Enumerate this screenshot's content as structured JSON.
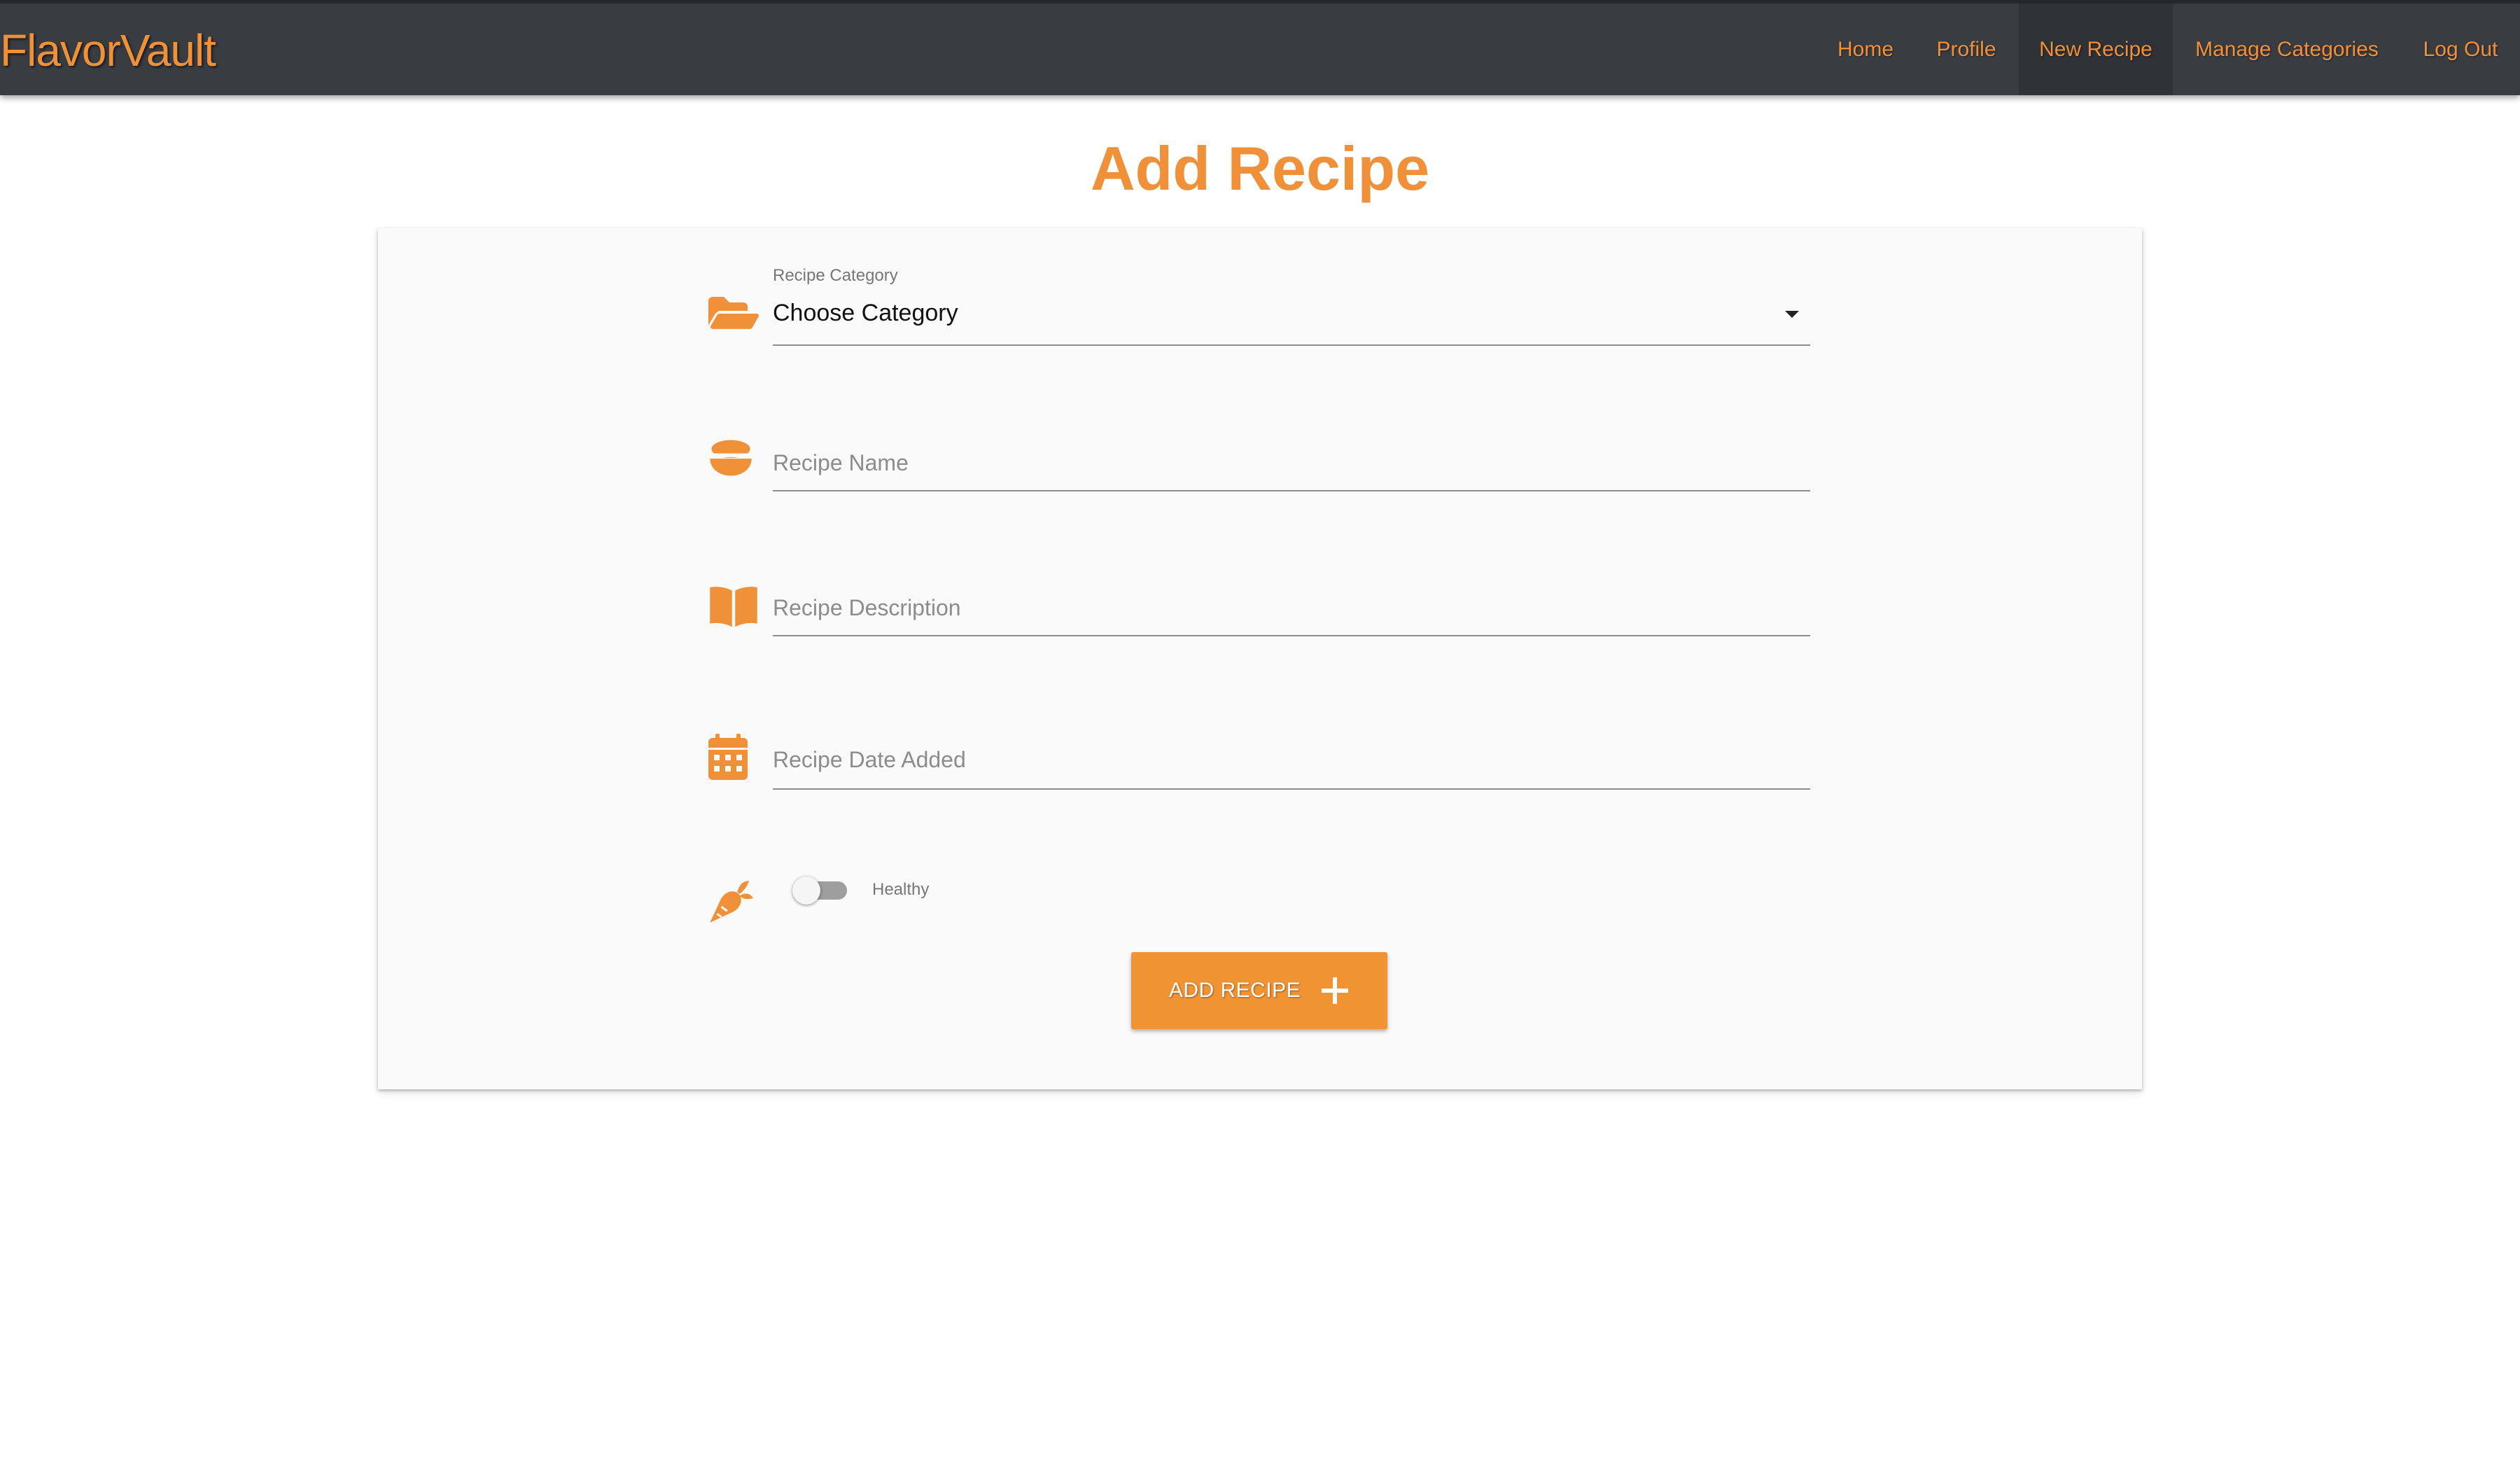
{
  "nav": {
    "brand": "FlavorVault",
    "links": [
      "Home",
      "Profile",
      "New Recipe",
      "Manage Categories",
      "Log Out"
    ],
    "active": "New Recipe"
  },
  "page": {
    "title": "Add Recipe"
  },
  "form": {
    "category": {
      "label": "Recipe Category",
      "value": "Choose Category",
      "icon": "folder-open-icon"
    },
    "name": {
      "placeholder": "Recipe Name",
      "icon": "bowl-icon"
    },
    "description": {
      "placeholder": "Recipe Description",
      "icon": "book-icon"
    },
    "date": {
      "placeholder": "Recipe Date Added",
      "icon": "calendar-icon"
    },
    "healthy": {
      "label": "Healthy",
      "checked": false,
      "icon": "carrot-icon"
    },
    "submit": {
      "label": "ADD RECIPE",
      "icon": "plus-icon"
    }
  },
  "colors": {
    "accent": "#f0913a",
    "navbar": "#393c41",
    "card": "#fafafa"
  }
}
